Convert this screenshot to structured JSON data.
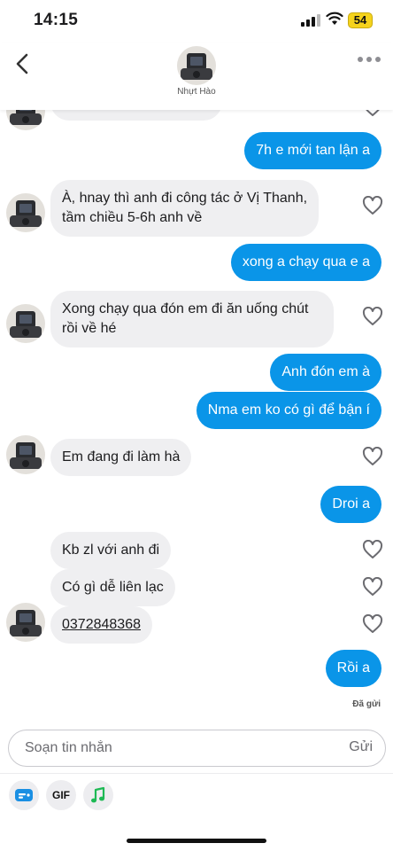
{
  "status_bar": {
    "time": "14:15",
    "battery": "54"
  },
  "header": {
    "contact_name": "Nhựt Hào"
  },
  "messages": [
    {
      "dir": "in",
      "text": ""
    },
    {
      "dir": "out",
      "text": "7h e mới tan lận a"
    },
    {
      "dir": "in",
      "lines": [
        "À, hnay thì anh đi công tác ở Vị Thanh,",
        "tầm chiều 5-6h anh về"
      ]
    },
    {
      "dir": "out",
      "text": "xong a chạy qua e a"
    },
    {
      "dir": "in",
      "lines": [
        "Xong chạy qua đón em đi ăn uống chút",
        "rồi về hé"
      ]
    },
    {
      "dir": "out",
      "text": "Anh đón em à"
    },
    {
      "dir": "out",
      "text": "Nma em ko có gì để bận í"
    },
    {
      "dir": "in",
      "text": "Em đang đi làm hà"
    },
    {
      "dir": "out",
      "text": "Droi a"
    },
    {
      "dir": "in",
      "text": "Kb zl với anh đi"
    },
    {
      "dir": "in",
      "text": "Có gì dễ liên lạc"
    },
    {
      "dir": "in",
      "text": "0372848368"
    },
    {
      "dir": "out",
      "text": "Rồi a"
    }
  ],
  "seen_label": "Đã gửi",
  "composer": {
    "placeholder": "Soạn tin nhắn",
    "send_label": "Gửi"
  },
  "toolbar": {
    "gif_label": "GIF"
  },
  "icons": {
    "back": "chevron-left-icon",
    "more": "more-dots-icon",
    "like": "heart-outline-icon",
    "sticker": "sticker-icon",
    "gif": "gif-icon",
    "music": "music-note-icon"
  },
  "colors": {
    "outgoing_bubble": "#0a95e8",
    "incoming_bubble": "#efeff1",
    "music_accent": "#1db954",
    "sticker_accent": "#1a8fe3",
    "battery": "#f5d31c"
  }
}
